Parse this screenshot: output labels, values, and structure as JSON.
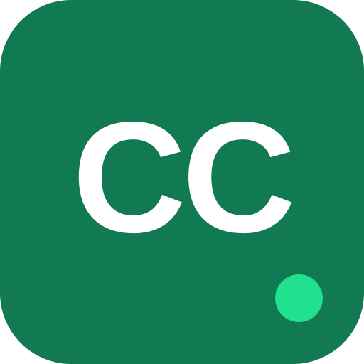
{
  "app_icon": {
    "monogram": "CC",
    "background_color": "#117a52",
    "text_color": "#ffffff"
  },
  "status_indicator": {
    "color": "#1fe190"
  }
}
